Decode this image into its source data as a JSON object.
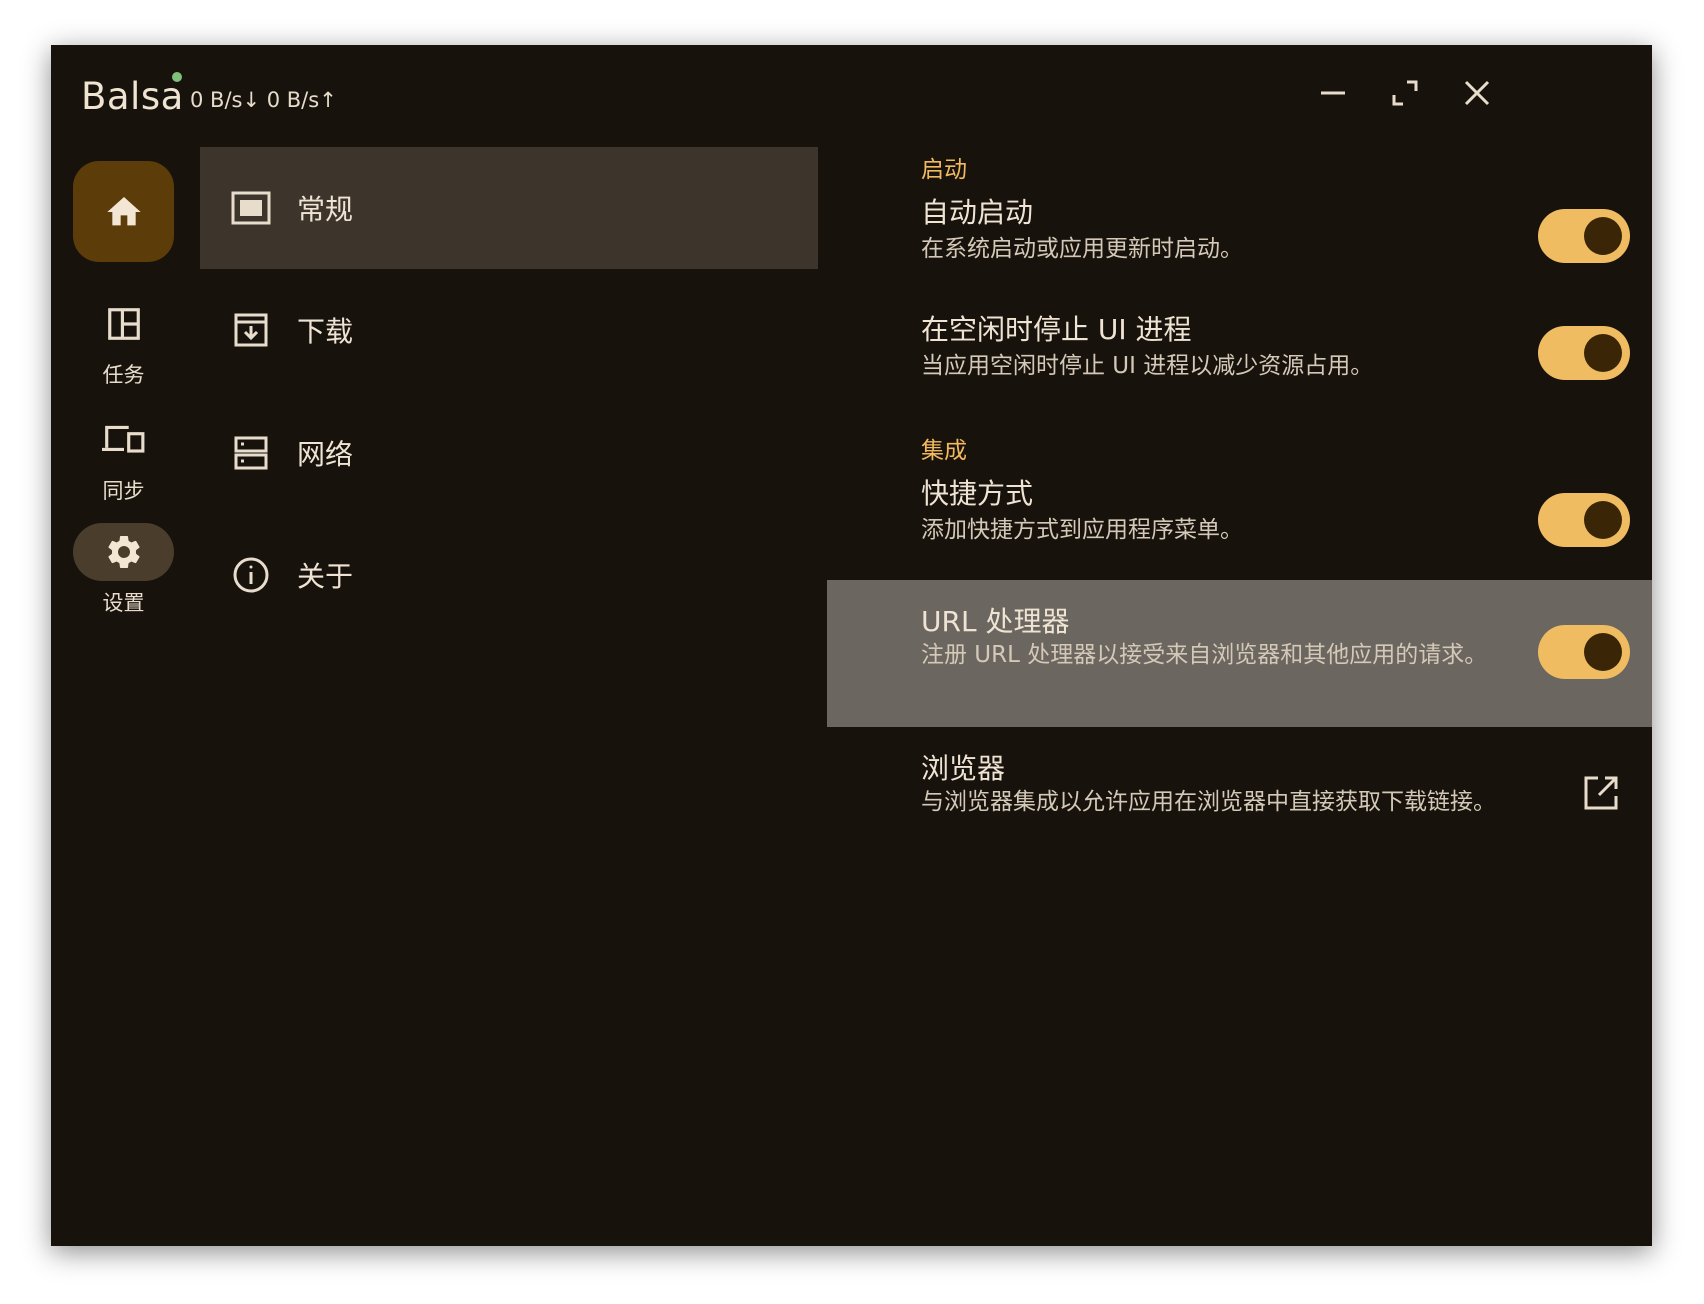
{
  "titlebar": {
    "app_name": "Balsa",
    "speed": "0 B/s↓ 0 B/s↑",
    "status_color": "#7fc07a"
  },
  "rail": {
    "home_icon": "home-icon",
    "items": [
      {
        "label": "任务",
        "icon": "dashboard-icon"
      },
      {
        "label": "同步",
        "icon": "devices-icon"
      },
      {
        "label": "设置",
        "icon": "gear-icon",
        "active": true
      }
    ]
  },
  "nav": {
    "items": [
      {
        "label": "常规",
        "icon": "monitor-icon",
        "selected": true
      },
      {
        "label": "下载",
        "icon": "download-box-icon"
      },
      {
        "label": "网络",
        "icon": "server-icon"
      },
      {
        "label": "关于",
        "icon": "info-icon"
      }
    ]
  },
  "settings": {
    "sections": [
      {
        "title": "启动"
      },
      {
        "title": "集成"
      }
    ],
    "rows": [
      {
        "title": "自动启动",
        "description": "在系统启动或应用更新时启动。",
        "enabled": true
      },
      {
        "title": "在空闲时停止 UI 进程",
        "description": "当应用空闲时停止 UI 进程以减少资源占用。",
        "enabled": true
      },
      {
        "title": "快捷方式",
        "description": "添加快捷方式到应用程序菜单。",
        "enabled": true
      },
      {
        "title": "URL 处理器",
        "description": "注册 URL 处理器以接受来自浏览器和其他应用的请求。",
        "enabled": true
      },
      {
        "title": "浏览器",
        "description": "与浏览器集成以允许应用在浏览器中直接获取下载链接。",
        "action_icon": "open-external-icon"
      }
    ]
  },
  "colors": {
    "accent": "#f2b95e",
    "toggle_on": "#efbc62",
    "background": "#17120c",
    "selected_nav": "#3d342b",
    "hover_row": "#6b6660"
  }
}
